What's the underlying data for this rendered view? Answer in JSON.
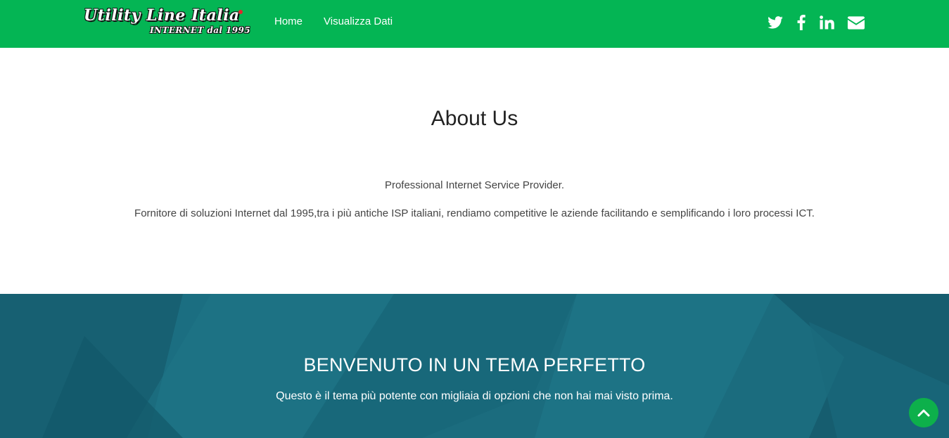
{
  "brand": {
    "logo_title": "Utility Line Italia",
    "logo_tagline": "INTERNET dal 1995"
  },
  "nav": {
    "items": [
      {
        "label": "Home"
      },
      {
        "label": "Visualizza Dati"
      }
    ]
  },
  "social": {
    "icons": [
      "twitter-icon",
      "facebook-icon",
      "linkedin-icon",
      "envelope-icon"
    ]
  },
  "about": {
    "title": "About Us",
    "tagline": "Professional Internet Service Provider.",
    "description": "Fornitore di soluzioni Internet dal 1995,tra i più antiche ISP italiani, rendiamo competitive le aziende facilitando e semplificando i loro processi ICT."
  },
  "hero": {
    "title": "BENVENUTO IN UN TEMA PERFETTO",
    "subtitle": "Questo è il tema più potente con migliaia di opzioni che non hai mai visto prima."
  },
  "back_to_top": {
    "icon": "chevron-up-icon"
  },
  "colors": {
    "navbar": "#04b554",
    "hero_bg": "#1a6b7d",
    "back_to_top": "#0db04b"
  }
}
